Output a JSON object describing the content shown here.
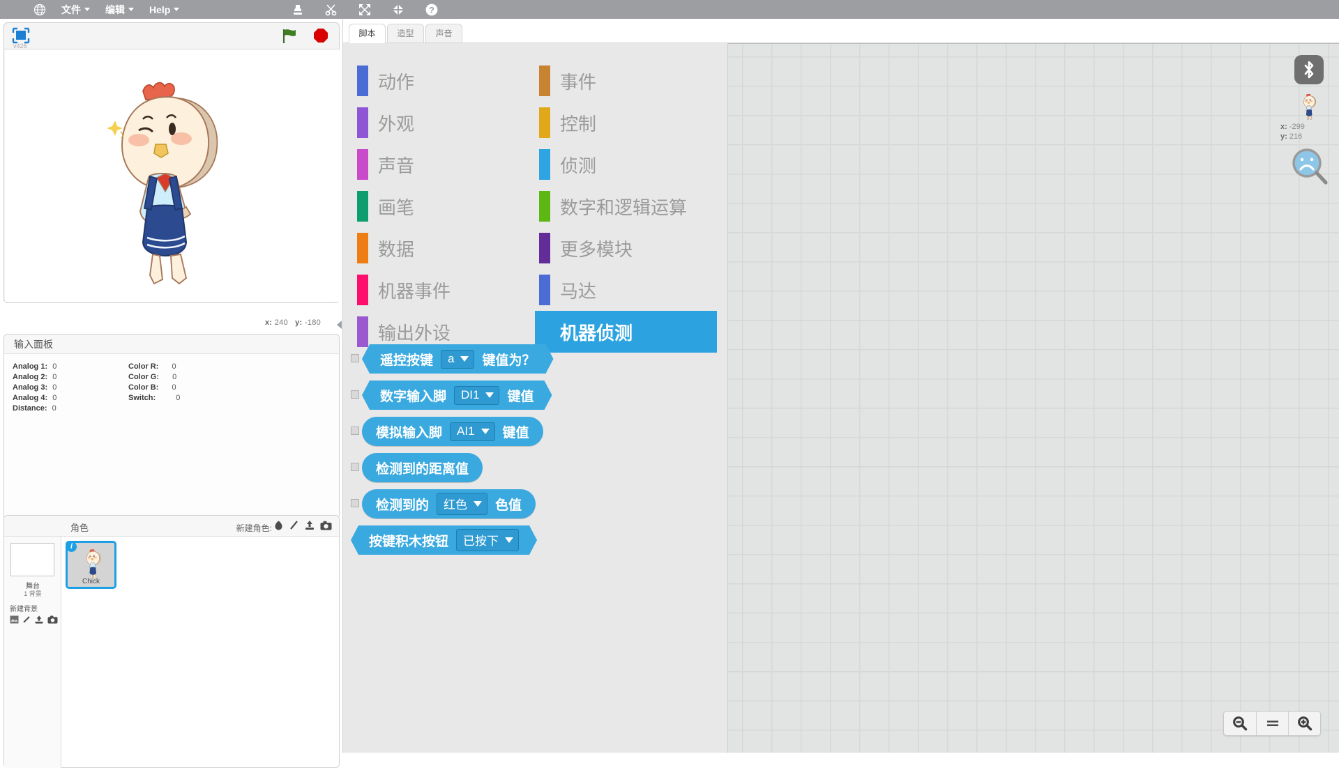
{
  "menubar": {
    "globe_icon": "globe-icon",
    "items": [
      {
        "label": "文件",
        "name": "file"
      },
      {
        "label": "编辑",
        "name": "edit"
      },
      {
        "label": "Help",
        "name": "help"
      }
    ],
    "tools": [
      {
        "icon": "stamp-icon"
      },
      {
        "icon": "scissors-icon"
      },
      {
        "icon": "grow-icon"
      },
      {
        "icon": "shrink-icon"
      },
      {
        "icon": "question-icon"
      }
    ]
  },
  "stage": {
    "version": "v426",
    "select_icon": "stage-select-icon",
    "green_flag_icon": "green-flag-icon",
    "stop_icon": "stop-sign-icon",
    "x_label": "x:",
    "x_value": "240",
    "y_label": "y:",
    "y_value": "-180"
  },
  "input_panel": {
    "title": "输入面板",
    "left_rows": [
      {
        "label": "Analog 1:",
        "value": "0"
      },
      {
        "label": "Analog 2:",
        "value": "0"
      },
      {
        "label": "Analog 3:",
        "value": "0"
      },
      {
        "label": "Analog 4:",
        "value": "0"
      },
      {
        "label": "Distance:",
        "value": "0"
      }
    ],
    "right_rows": [
      {
        "label": "Color R:",
        "value": "0"
      },
      {
        "label": "Color G:",
        "value": "0"
      },
      {
        "label": "Color B:",
        "value": "0"
      },
      {
        "label": "Switch:",
        "value": "0"
      }
    ]
  },
  "sprite_panel": {
    "title": "角色",
    "new_sprite_label": "新建角色:",
    "new_sprite_icons": [
      "library-sprite-icon",
      "paint-sprite-icon",
      "upload-sprite-icon",
      "camera-sprite-icon"
    ],
    "stage_label": "舞台",
    "stage_sub": "1 背景",
    "new_backdrop_label": "新建背景",
    "new_backdrop_icons": [
      "library-backdrop-icon",
      "paint-backdrop-icon",
      "upload-backdrop-icon",
      "camera-backdrop-icon"
    ],
    "sprites": [
      {
        "name": "Chick",
        "selected": true,
        "info_badge": "i"
      }
    ]
  },
  "editor": {
    "tabs": [
      {
        "label": "脚本",
        "name": "scripts",
        "active": true
      },
      {
        "label": "造型",
        "name": "costumes",
        "active": false
      },
      {
        "label": "声音",
        "name": "sounds",
        "active": false
      }
    ]
  },
  "palette": {
    "categories": [
      {
        "label": "动作",
        "color": "#4a6cd4",
        "selected": false
      },
      {
        "label": "事件",
        "color": "#c88330",
        "selected": false
      },
      {
        "label": "外观",
        "color": "#8e55d4",
        "selected": false
      },
      {
        "label": "控制",
        "color": "#e1a91a",
        "selected": false
      },
      {
        "label": "声音",
        "color": "#c94bc9",
        "selected": false
      },
      {
        "label": "侦测",
        "color": "#2ca5e2",
        "selected": false
      },
      {
        "label": "画笔",
        "color": "#0e9d6e",
        "selected": false
      },
      {
        "label": "数字和逻辑运算",
        "color": "#5cb712",
        "selected": false
      },
      {
        "label": "数据",
        "color": "#ee7d16",
        "selected": false
      },
      {
        "label": "更多模块",
        "color": "#632d99",
        "selected": false
      },
      {
        "label": "机器事件",
        "color": "#ff0f6c",
        "selected": false
      },
      {
        "label": "马达",
        "color": "#4a6cd4",
        "selected": false
      },
      {
        "label": "输出外设",
        "color": "#9b59d0",
        "selected": false
      },
      {
        "label": "机器侦测",
        "color": "#2ca3e0",
        "selected": true
      }
    ],
    "blocks": [
      {
        "name": "remote-key-value-block",
        "shape": "hex",
        "checkbox": true,
        "parts": [
          {
            "type": "text",
            "value": "遥控按键"
          },
          {
            "type": "dropdown",
            "value": "a"
          },
          {
            "type": "text",
            "value": "键值为？"
          }
        ]
      },
      {
        "name": "digital-input-pin-block",
        "shape": "hex",
        "checkbox": true,
        "parts": [
          {
            "type": "text",
            "value": "数字输入脚"
          },
          {
            "type": "dropdown",
            "value": "DI1"
          },
          {
            "type": "text",
            "value": "键值"
          }
        ]
      },
      {
        "name": "analog-input-pin-block",
        "shape": "round",
        "checkbox": true,
        "parts": [
          {
            "type": "text",
            "value": "模拟输入脚"
          },
          {
            "type": "dropdown",
            "value": "AI1"
          },
          {
            "type": "text",
            "value": "键值"
          }
        ]
      },
      {
        "name": "detected-distance-block",
        "shape": "round",
        "checkbox": true,
        "parts": [
          {
            "type": "text",
            "value": "检测到的距离值"
          }
        ]
      },
      {
        "name": "detected-color-value-block",
        "shape": "round",
        "checkbox": true,
        "parts": [
          {
            "type": "text",
            "value": "检测到的"
          },
          {
            "type": "dropdown",
            "value": "红色"
          },
          {
            "type": "text",
            "value": "色值"
          }
        ]
      },
      {
        "name": "button-brick-block",
        "shape": "hex",
        "checkbox": false,
        "parts": [
          {
            "type": "text",
            "value": "按键积木按钮"
          },
          {
            "type": "dropdown",
            "value": "已按下"
          }
        ]
      }
    ]
  },
  "script_area": {
    "bluetooth_icon": "bluetooth-icon",
    "mini_sprite_icon": "sprite-thumbnail-icon",
    "mini_x_label": "x:",
    "mini_x_value": "-299",
    "mini_y_label": "y:",
    "mini_y_value": "216",
    "magnifier_icon": "magnifier-sad-icon",
    "zoom_out_icon": "zoom-out-icon",
    "zoom_reset_icon": "zoom-reset-icon",
    "zoom_in_icon": "zoom-in-icon"
  },
  "colors": {
    "menubar_bg": "#9c9ea1",
    "palette_bg": "#e8e8e8",
    "block_blue": "#3aa9e0",
    "selected_cat": "#2ca3e0",
    "script_bg": "#e2e4e3"
  }
}
